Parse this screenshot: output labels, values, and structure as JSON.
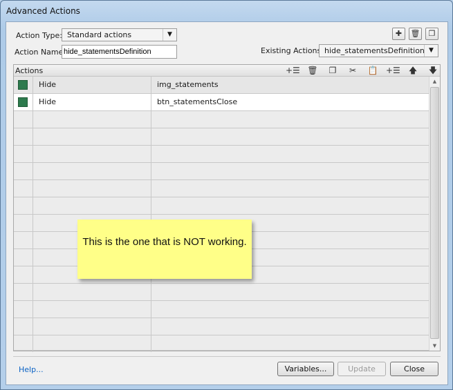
{
  "window": {
    "title": "Advanced Actions"
  },
  "form": {
    "action_type_label": "Action Type:",
    "action_type_value": "Standard actions",
    "action_name_label": "Action Name:",
    "action_name_value": "hide_statementsDefinition",
    "existing_actions_label": "Existing Actions:",
    "existing_actions_value": "hide_statementsDefinition"
  },
  "top_icons": [
    "add-icon",
    "trash-icon",
    "duplicate-icon"
  ],
  "grid": {
    "title": "Actions",
    "toolbar_icons": [
      "add-row-icon",
      "delete-row-icon",
      "copy-icon",
      "cut-icon",
      "paste-icon",
      "insert-row-icon",
      "move-up-icon",
      "move-down-icon"
    ],
    "rows": [
      {
        "action": "Hide",
        "target": "img_statements"
      },
      {
        "action": "Hide",
        "target": "btn_statementsClose"
      }
    ]
  },
  "note": {
    "text": "This is the one that is NOT working."
  },
  "footer": {
    "help_label": "Help...",
    "variables_label": "Variables...",
    "update_label": "Update",
    "close_label": "Close"
  },
  "colors": {
    "checkbox_green": "#2d7a4d",
    "sticky_yellow": "#ffff88",
    "link_blue": "#0a62c4"
  }
}
